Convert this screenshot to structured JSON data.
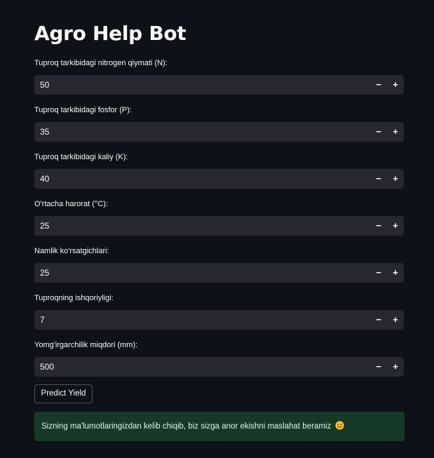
{
  "app": {
    "title": "Agro Help Bot"
  },
  "colors": {
    "background": "#0e1117",
    "input_background": "#262730",
    "text": "#fafafa",
    "success_background": "#173928",
    "success_text": "#dff7e4"
  },
  "fields": [
    {
      "label": "Tuproq tarkibidagi nitrogen qiymati (N):",
      "value": "50",
      "minus": "−",
      "plus": "+"
    },
    {
      "label": "Tuproq tarkibidagi fosfor (P):",
      "value": "35",
      "minus": "−",
      "plus": "+"
    },
    {
      "label": "Tuproq tarkibidagi kaliy (K):",
      "value": "40",
      "minus": "−",
      "plus": "+"
    },
    {
      "label": "O'rtacha harorat (°C):",
      "value": "25",
      "minus": "−",
      "plus": "+"
    },
    {
      "label": "Namlik ko'rsatgichlari:",
      "value": "25",
      "minus": "−",
      "plus": "+"
    },
    {
      "label": "Tuproqning ishqoriyligi:",
      "value": "7",
      "minus": "−",
      "plus": "+"
    },
    {
      "label": "Yomg'irgarchilik miqdori (mm):",
      "value": "500",
      "minus": "−",
      "plus": "+"
    }
  ],
  "predict_button": {
    "label": "Predict Yield"
  },
  "result": {
    "message": "Sizning ma'lumotlaringizdan kelib chiqib, biz sizga anor ekishni maslahat beramiz",
    "emoji_icon": "smiling-face-icon"
  }
}
